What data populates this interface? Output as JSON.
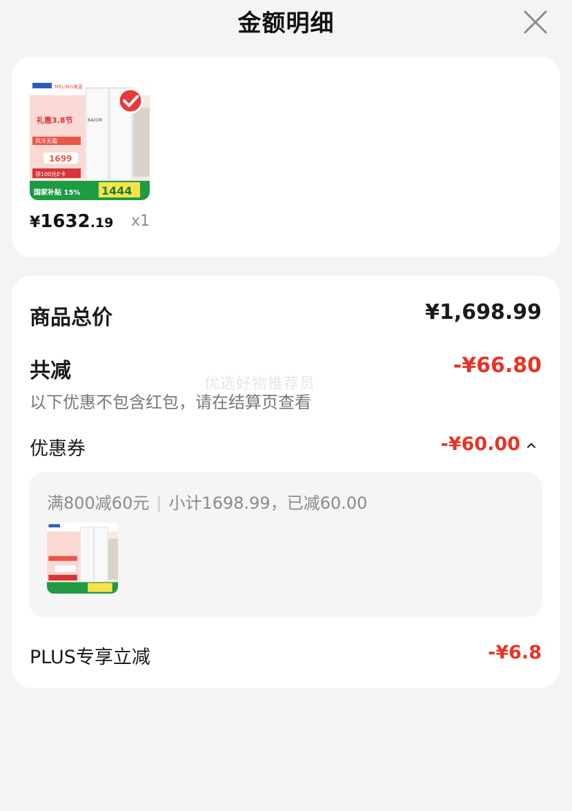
{
  "header": {
    "title": "金额明细"
  },
  "product": {
    "image_alt": "Meling refrigerator product image",
    "price_currency": "¥",
    "price_integer": "1632",
    "price_decimal": ".19",
    "quantity": "x1",
    "image_text": {
      "brand": "MELING美菱",
      "promo": "礼惠3.8节",
      "feature": "风冷无霜",
      "size": "642CM",
      "price_a": "1699",
      "price_b": "1444",
      "subsidy": "国家补贴 15%",
      "coupon": "领100元E卡"
    }
  },
  "summary": {
    "total_label": "商品总价",
    "total_value": "¥1,698.99",
    "reduce_label": "共减",
    "reduce_value": "-¥66.80",
    "reduce_hint": "以下优惠不包含红包，请在结算页查看",
    "coupon_label": "优惠券",
    "coupon_value": "-¥60.00",
    "coupon_detail_rule": "满800减60元",
    "coupon_detail_calc": "小计1698.99，已减60.00",
    "plus_label": "PLUS专享立减",
    "plus_value": "-¥6.8"
  },
  "watermark": "优选好物推荐员",
  "colors": {
    "accent_red": "#e93324",
    "background": "#f4f4f4",
    "card": "#ffffff"
  }
}
